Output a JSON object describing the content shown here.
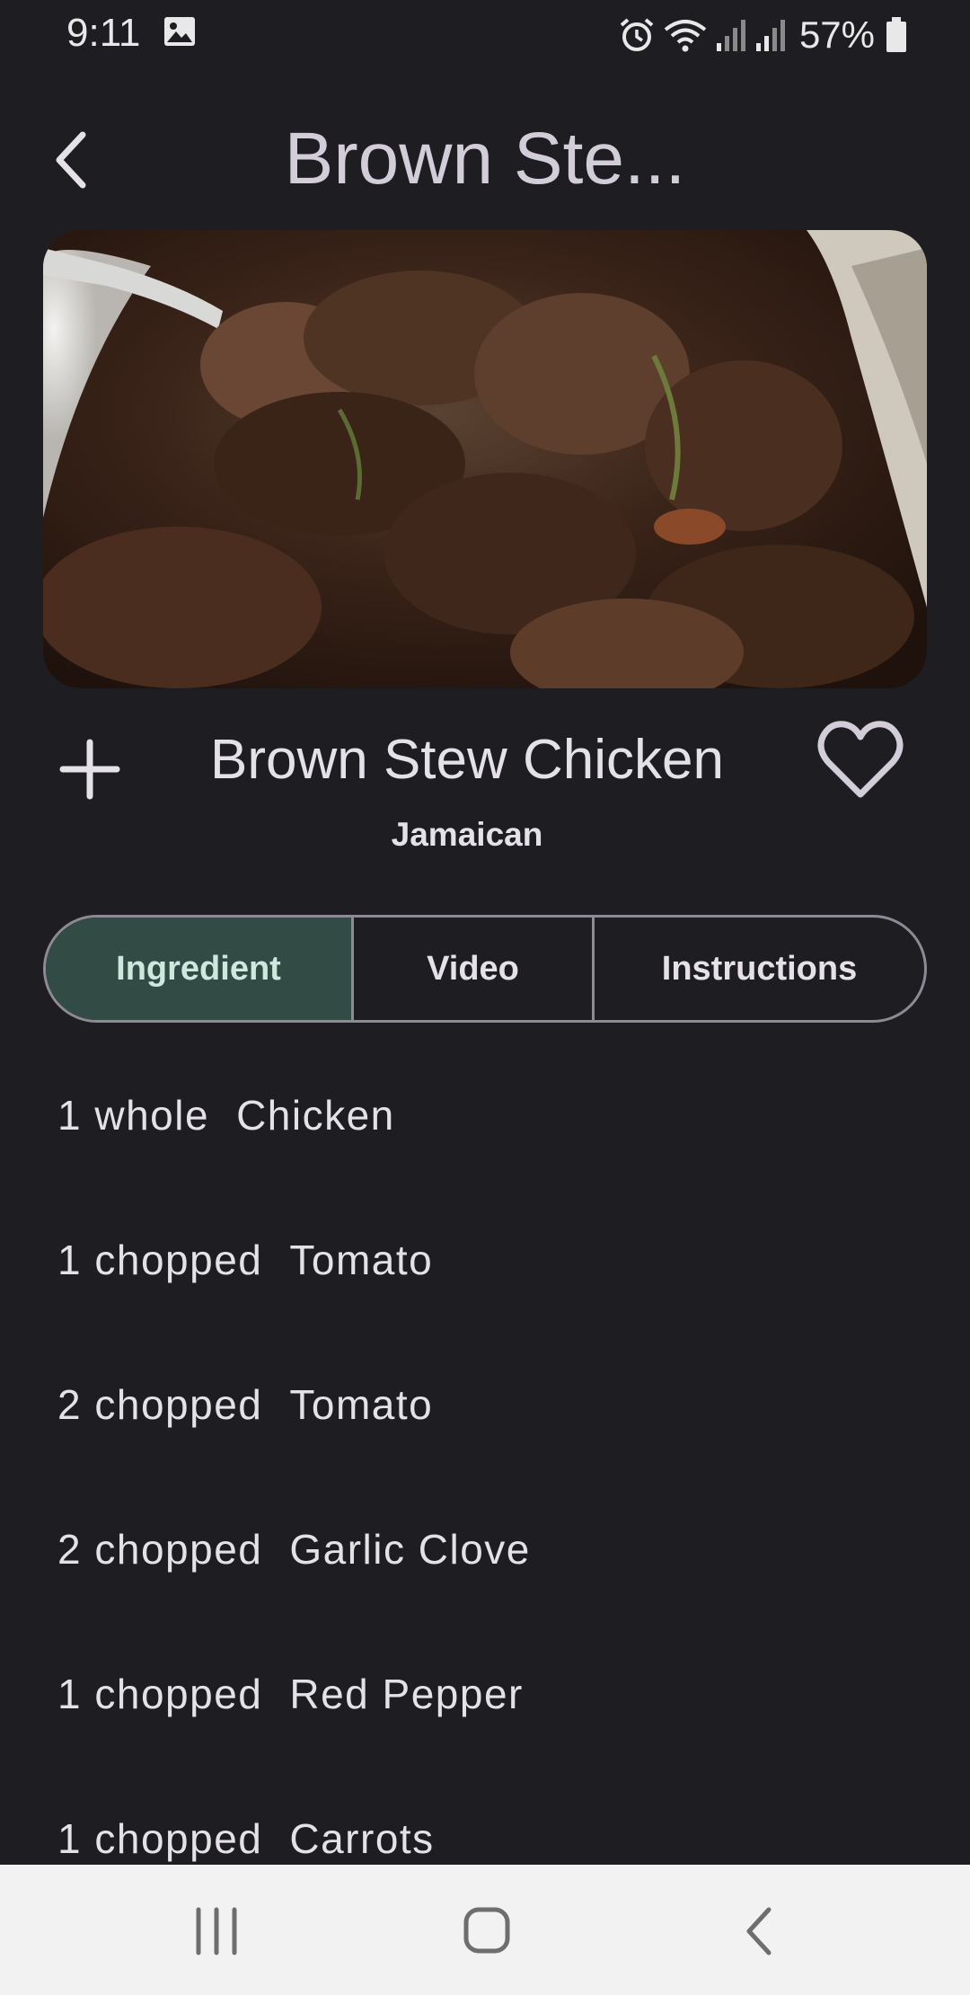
{
  "status_bar": {
    "time": "9:11",
    "battery": "57%",
    "icons": [
      "gallery-icon",
      "alarm-icon",
      "wifi-icon",
      "signal-icon",
      "signal-icon",
      "battery-icon"
    ]
  },
  "app_bar": {
    "title": "Brown Ste...",
    "back_icon": "chevron-left-icon"
  },
  "recipe": {
    "name": "Brown Stew Chicken",
    "area": "Jamaican",
    "add_icon": "plus-icon",
    "favorite_icon": "heart-outline-icon"
  },
  "tabs": [
    {
      "label": "Ingredient",
      "selected": true
    },
    {
      "label": "Video",
      "selected": false
    },
    {
      "label": "Instructions",
      "selected": false
    }
  ],
  "ingredients": [
    {
      "measure": "1 whole",
      "name": "Chicken"
    },
    {
      "measure": "1 chopped",
      "name": "Tomato"
    },
    {
      "measure": "2 chopped",
      "name": "Tomato"
    },
    {
      "measure": "2 chopped",
      "name": "Garlic Clove"
    },
    {
      "measure": "1 chopped",
      "name": "Red Pepper"
    },
    {
      "measure": "1 chopped",
      "name": "Carrots"
    }
  ],
  "nav_bar": {
    "icons": [
      "recents-icon",
      "home-icon",
      "back-icon"
    ]
  },
  "colors": {
    "background": "#1e1d22",
    "active_tab": "#334b45",
    "nav_bar": "#f2f2f2"
  }
}
